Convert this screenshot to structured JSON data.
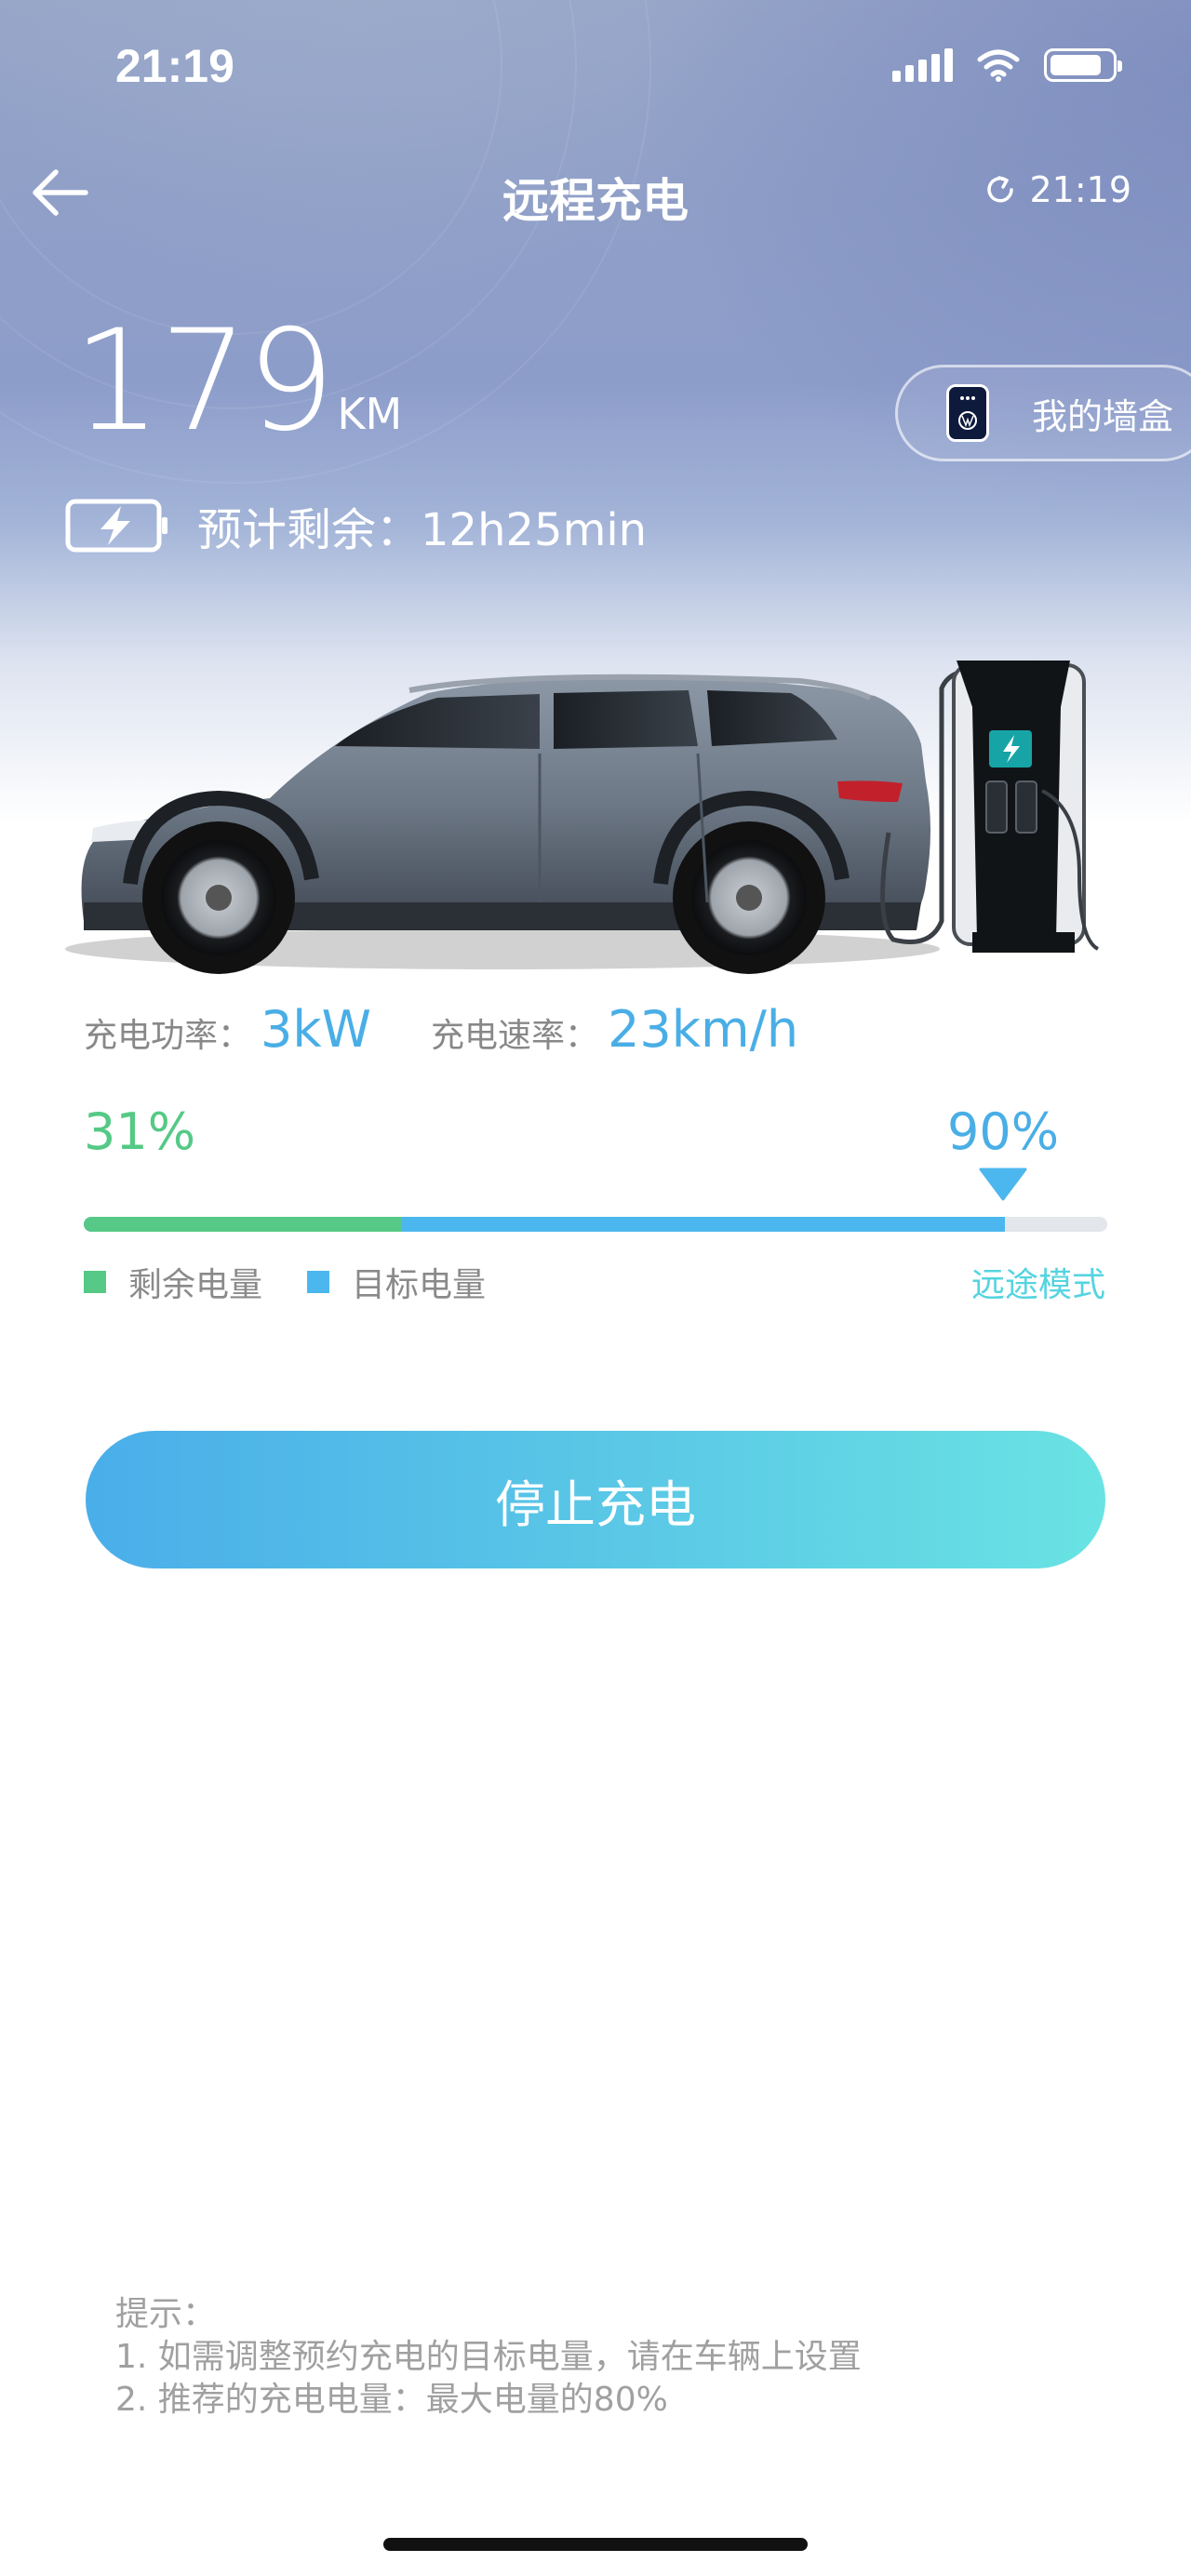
{
  "status_bar": {
    "time": "21:19"
  },
  "header": {
    "title": "远程充电",
    "refresh_time": "21:19"
  },
  "vehicle": {
    "range_value": "179",
    "range_unit": "KM",
    "estimate_text": "预计剩余：12h25min"
  },
  "wallbox": {
    "label": "我的墙盒"
  },
  "metrics": {
    "power_label": "充电功率：",
    "power_value": "3kW",
    "speed_label": "充电速率：",
    "speed_value": "23km/h"
  },
  "charge": {
    "current_percent": 31,
    "current_label": "31%",
    "target_percent": 90,
    "target_label": "90%",
    "legend_current": "剩余电量",
    "legend_target": "目标电量",
    "mode_label": "远途模式"
  },
  "colors": {
    "green": "#55c985",
    "blue": "#4cb7ee",
    "teal": "#55d4e0"
  },
  "actions": {
    "stop_label": "停止充电"
  },
  "tips": {
    "title": "提示：",
    "line1": "1. 如需调整预约充电的目标电量，请在车辆上设置",
    "line2": "2. 推荐的充电电量：最大电量的80%"
  }
}
